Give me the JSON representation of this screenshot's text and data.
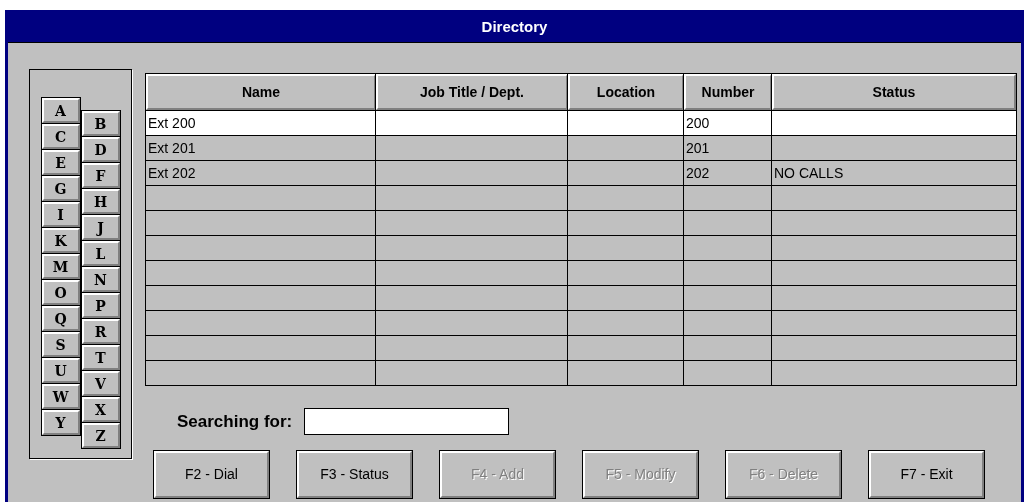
{
  "window": {
    "title": "Directory"
  },
  "letters": [
    {
      "label": "A"
    },
    {
      "label": "B"
    },
    {
      "label": "C"
    },
    {
      "label": "D"
    },
    {
      "label": "E"
    },
    {
      "label": "F"
    },
    {
      "label": "G"
    },
    {
      "label": "H"
    },
    {
      "label": "I"
    },
    {
      "label": "J"
    },
    {
      "label": "K"
    },
    {
      "label": "L"
    },
    {
      "label": "M"
    },
    {
      "label": "N"
    },
    {
      "label": "O"
    },
    {
      "label": "P"
    },
    {
      "label": "Q"
    },
    {
      "label": "R"
    },
    {
      "label": "S"
    },
    {
      "label": "T"
    },
    {
      "label": "U"
    },
    {
      "label": "V"
    },
    {
      "label": "W"
    },
    {
      "label": "X"
    },
    {
      "label": "Y"
    },
    {
      "label": "Z"
    }
  ],
  "table": {
    "columns": [
      "Name",
      "Job Title / Dept.",
      "Location",
      "Number",
      "Status"
    ],
    "rows": [
      {
        "cells": [
          "Ext 200",
          "",
          "",
          "200",
          ""
        ],
        "selected": true
      },
      {
        "cells": [
          "Ext 201",
          "",
          "",
          "201",
          ""
        ],
        "selected": false
      },
      {
        "cells": [
          "Ext 202",
          "",
          "",
          "202",
          "NO CALLS"
        ],
        "selected": false
      }
    ]
  },
  "search": {
    "label": "Searching for:"
  },
  "buttons": [
    {
      "label": "F2 - Dial",
      "disabled": false
    },
    {
      "label": "F3 - Status",
      "disabled": false
    },
    {
      "label": "F4 - Add",
      "disabled": true
    },
    {
      "label": "F5 - Modify",
      "disabled": true
    },
    {
      "label": "F6 - Delete",
      "disabled": true
    },
    {
      "label": "F7 - Exit",
      "disabled": false
    }
  ]
}
